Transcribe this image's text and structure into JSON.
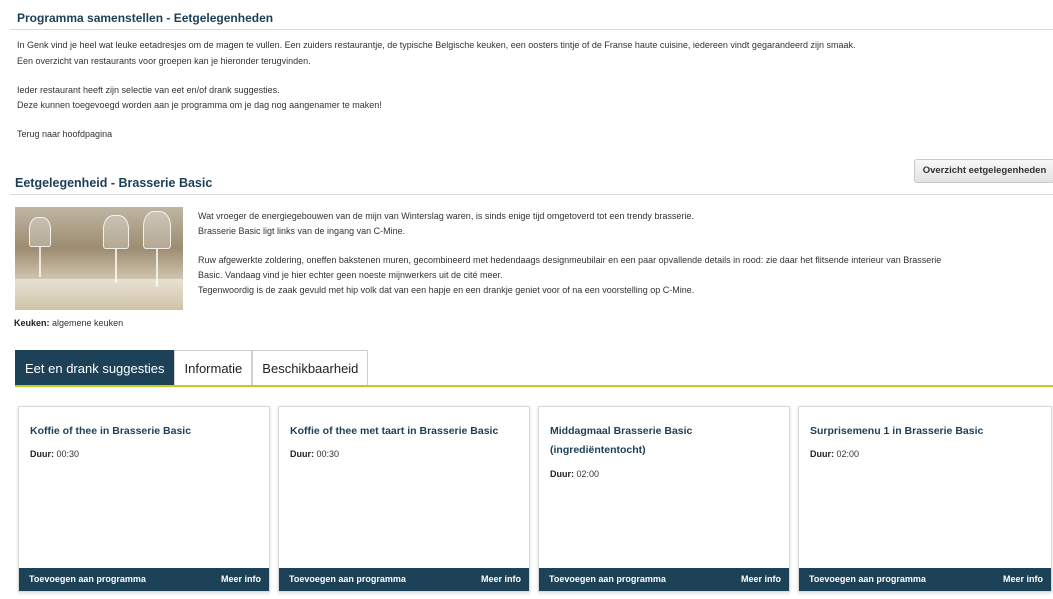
{
  "page_title": "Programma samenstellen - Eetgelegenheden",
  "intro": [
    "In Genk vind je heel wat leuke eetadresjes om de magen te vullen.  Een zuiders restaurantje, de typische Belgische keuken, een oosters tintje of de Franse haute cuisine, iedereen vindt gegarandeerd zijn smaak.",
    "Een overzicht van restaurants voor groepen kan je hieronder terugvinden.",
    "Ieder restaurant heeft zijn selectie van eet en/of drank suggesties.",
    "Deze kunnen toegevoegd worden aan je programma om je dag nog aangenamer te maken!"
  ],
  "back_link": "Terug naar hoofdpagina",
  "overview_button": "Overzicht eetgelegenheden",
  "venue": {
    "title": "Eetgelegenheid - Brasserie Basic",
    "description": [
      "Wat vroeger de energiegebouwen van de mijn van Winterslag waren, is sinds enige tijd omgetoverd tot een trendy brasserie.",
      "Brasserie Basic ligt links van de ingang van C-Mine.",
      "Ruw afgewerkte zoldering, oneffen bakstenen muren, gecombineerd met hedendaags designmeubilair en een paar opvallende details in rood: zie daar het flitsende interieur van Brasserie",
      "Basic. Vandaag vind je hier echter geen noeste mijnwerkers uit de cité meer.",
      "Tegenwoordig is de zaak gevuld met hip volk dat van een hapje en een drankje geniet voor of na een voorstelling op C-Mine."
    ],
    "kitchen_label": "Keuken:",
    "kitchen_value": "algemene keuken"
  },
  "tabs": [
    {
      "label": "Eet en drank suggesties",
      "active": true
    },
    {
      "label": "Informatie",
      "active": false
    },
    {
      "label": "Beschikbaarheid",
      "active": false
    }
  ],
  "cards": [
    {
      "title": "Koffie of thee in Brasserie Basic",
      "duration_label": "Duur:",
      "duration": "00:30",
      "add_label": "Toevoegen aan programma",
      "more_label": "Meer info"
    },
    {
      "title": "Koffie of thee met taart in Brasserie Basic",
      "duration_label": "Duur:",
      "duration": "00:30",
      "add_label": "Toevoegen aan programma",
      "more_label": "Meer info"
    },
    {
      "title": "Middagmaal Brasserie Basic (ingrediëntentocht)",
      "duration_label": "Duur:",
      "duration": "02:00",
      "add_label": "Toevoegen aan programma",
      "more_label": "Meer info"
    },
    {
      "title": "Surprisemenu 1 in Brasserie Basic",
      "duration_label": "Duur:",
      "duration": "02:00",
      "add_label": "Toevoegen aan programma",
      "more_label": "Meer info"
    }
  ],
  "colors": {
    "primary": "#1d4257",
    "title": "#1c3f56",
    "accent_line": "#c8c81e"
  }
}
